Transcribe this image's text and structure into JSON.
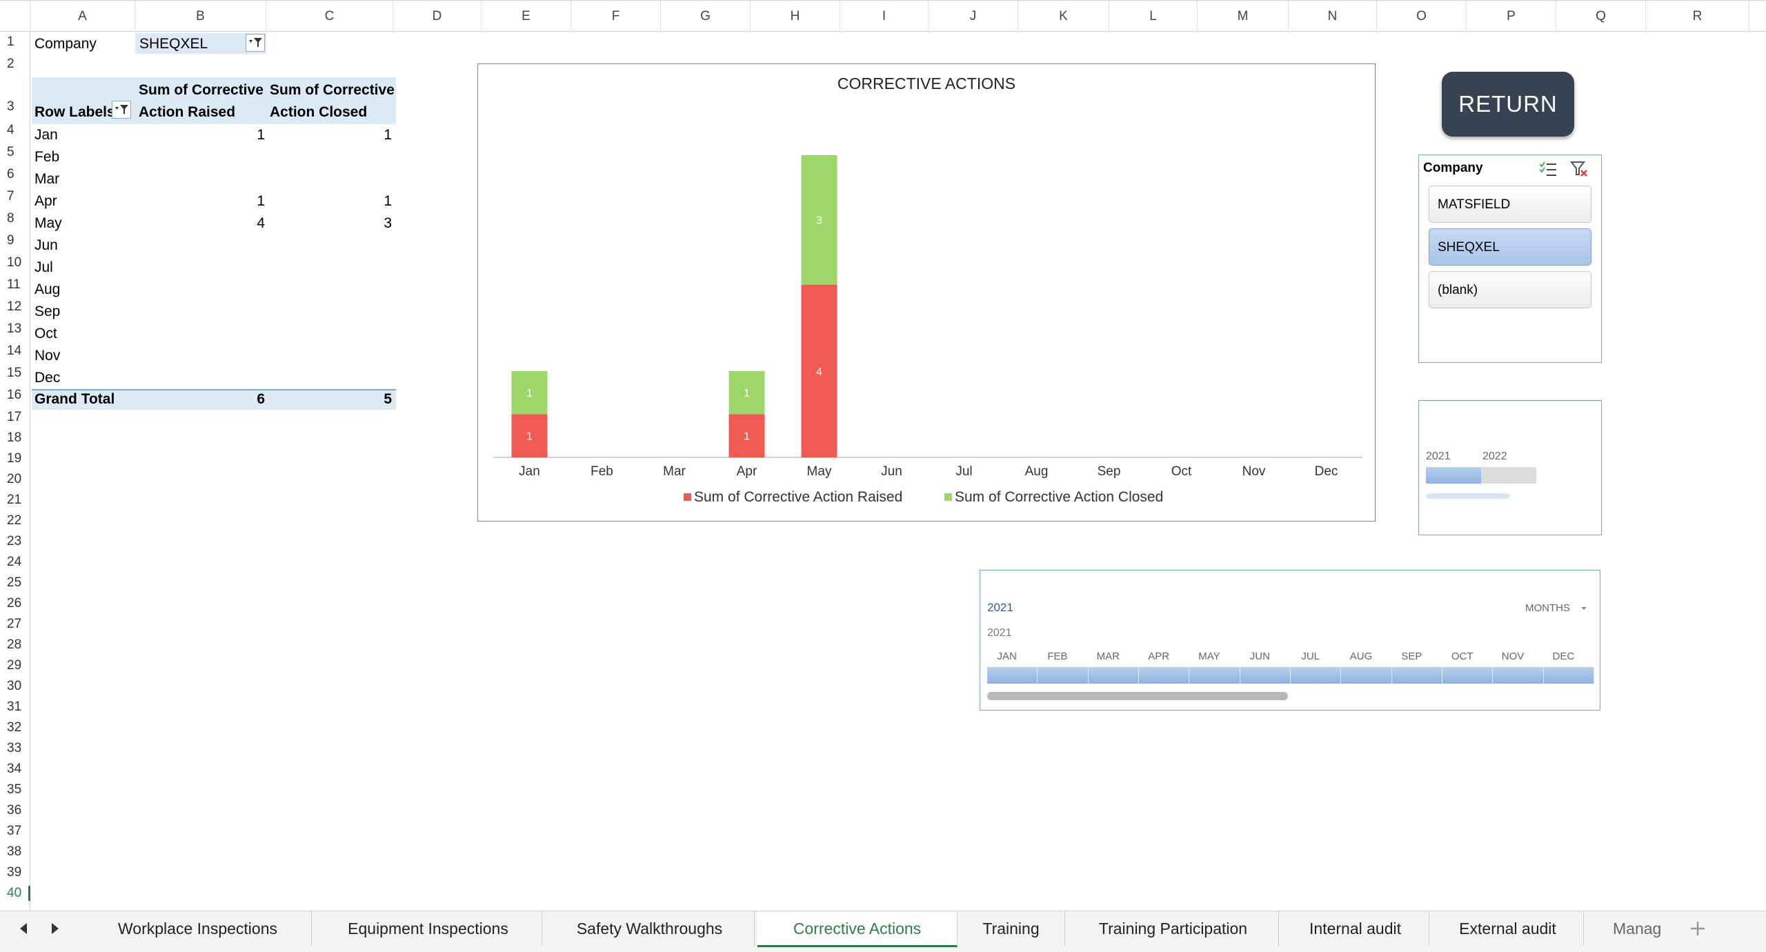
{
  "columns": [
    "A",
    "B",
    "C",
    "D",
    "E",
    "F",
    "G",
    "H",
    "I",
    "J",
    "K",
    "L",
    "M",
    "N",
    "O",
    "P",
    "Q",
    "R"
  ],
  "rows": [
    "1",
    "2",
    "3",
    "4",
    "5",
    "6",
    "7",
    "8",
    "9",
    "10",
    "11",
    "12",
    "13",
    "14",
    "15",
    "16",
    "17",
    "18",
    "19",
    "20",
    "21",
    "22",
    "23",
    "24",
    "25",
    "26",
    "27",
    "28",
    "29",
    "30",
    "31",
    "32",
    "33",
    "34",
    "35",
    "36",
    "37",
    "38",
    "39",
    "40"
  ],
  "filter": {
    "label": "Company",
    "value": "SHEQXEL"
  },
  "pivot": {
    "row_labels_header": "Row Labels",
    "col1_header_line1": "Sum of Corrective",
    "col1_header_line2": "Action Raised",
    "col2_header_line1": "Sum of Corrective",
    "col2_header_line2": "Action Closed",
    "rows": [
      {
        "label": "Jan",
        "raised": "1",
        "closed": "1"
      },
      {
        "label": "Feb",
        "raised": "",
        "closed": ""
      },
      {
        "label": "Mar",
        "raised": "",
        "closed": ""
      },
      {
        "label": "Apr",
        "raised": "1",
        "closed": "1"
      },
      {
        "label": "May",
        "raised": "4",
        "closed": "3"
      },
      {
        "label": "Jun",
        "raised": "",
        "closed": ""
      },
      {
        "label": "Jul",
        "raised": "",
        "closed": ""
      },
      {
        "label": "Aug",
        "raised": "",
        "closed": ""
      },
      {
        "label": "Sep",
        "raised": "",
        "closed": ""
      },
      {
        "label": "Oct",
        "raised": "",
        "closed": ""
      },
      {
        "label": "Nov",
        "raised": "",
        "closed": ""
      },
      {
        "label": "Dec",
        "raised": "",
        "closed": ""
      }
    ],
    "total_label": "Grand Total",
    "total_raised": "6",
    "total_closed": "5"
  },
  "chart_data": {
    "type": "bar",
    "stacked": true,
    "title": "CORRECTIVE ACTIONS",
    "categories": [
      "Jan",
      "Feb",
      "Mar",
      "Apr",
      "May",
      "Jun",
      "Jul",
      "Aug",
      "Sep",
      "Oct",
      "Nov",
      "Dec"
    ],
    "series": [
      {
        "name": "Sum of Corrective Action Raised",
        "values": [
          1,
          0,
          0,
          1,
          4,
          0,
          0,
          0,
          0,
          0,
          0,
          0
        ],
        "color": "#ef5a52"
      },
      {
        "name": "Sum of Corrective Action Closed",
        "values": [
          1,
          0,
          0,
          1,
          3,
          0,
          0,
          0,
          0,
          0,
          0,
          0
        ],
        "color": "#9fd66a"
      }
    ],
    "grid": false,
    "legend": "bottom"
  },
  "return_button": {
    "label": "RETURN"
  },
  "slicer": {
    "title": "Company",
    "items": [
      {
        "label": "MATSFIELD",
        "selected": false
      },
      {
        "label": "SHEQXEL",
        "selected": true
      },
      {
        "label": "(blank)",
        "selected": false
      }
    ]
  },
  "year_timeline": {
    "years": [
      "2021",
      "2022"
    ]
  },
  "month_timeline": {
    "period_label": "2021",
    "level_label": "MONTHS",
    "year_label": "2021",
    "months": [
      "JAN",
      "FEB",
      "MAR",
      "APR",
      "MAY",
      "JUN",
      "JUL",
      "AUG",
      "SEP",
      "OCT",
      "NOV",
      "DEC"
    ]
  },
  "tabs": [
    {
      "label": "Workplace Inspections",
      "active": false
    },
    {
      "label": "Equipment Inspections",
      "active": false
    },
    {
      "label": "Safety Walkthroughs",
      "active": false
    },
    {
      "label": "Corrective Actions",
      "active": true
    },
    {
      "label": "Training",
      "active": false
    },
    {
      "label": "Training Participation",
      "active": false
    },
    {
      "label": "Internal audit",
      "active": false
    },
    {
      "label": "External audit",
      "active": false
    },
    {
      "label": "Manag",
      "active": false
    }
  ],
  "colors": {
    "accent": "#2e7d45",
    "button_bg": "#374252",
    "pivot_band": "#dce9f7"
  }
}
